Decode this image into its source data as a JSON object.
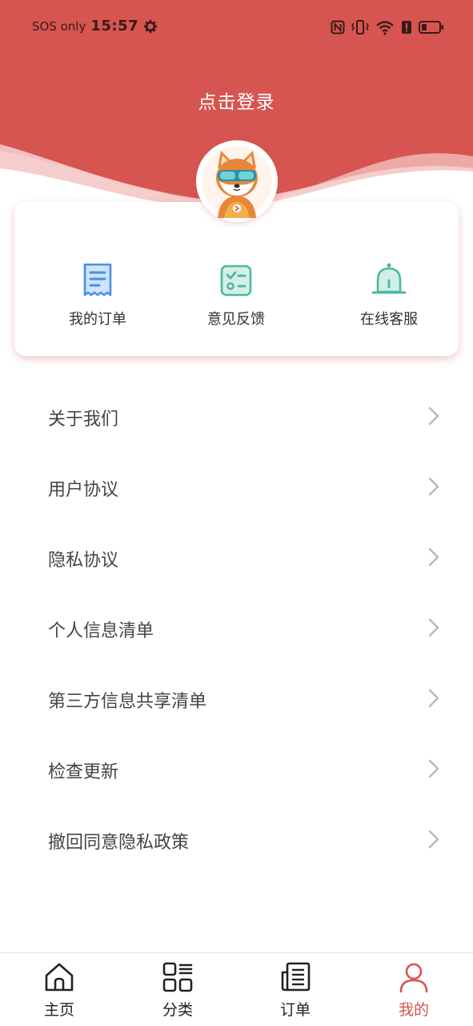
{
  "status_bar": {
    "carrier": "SOS only",
    "time": "15:57"
  },
  "header": {
    "login_text": "点击登录",
    "brand_color": "#d65550"
  },
  "quick_actions": [
    {
      "label": "我的订单",
      "icon": "order-doc-icon",
      "color": "#4a90e2"
    },
    {
      "label": "意见反馈",
      "icon": "feedback-checklist-icon",
      "color": "#4fb8a0"
    },
    {
      "label": "在线客服",
      "icon": "bell-icon",
      "color": "#4fb8a0"
    }
  ],
  "menu": [
    {
      "label": "关于我们"
    },
    {
      "label": "用户协议"
    },
    {
      "label": "隐私协议"
    },
    {
      "label": "个人信息清单"
    },
    {
      "label": "第三方信息共享清单"
    },
    {
      "label": "检查更新"
    },
    {
      "label": "撤回同意隐私政策"
    }
  ],
  "tabs": [
    {
      "label": "主页",
      "icon": "home-icon",
      "active": false
    },
    {
      "label": "分类",
      "icon": "category-grid-icon",
      "active": false
    },
    {
      "label": "订单",
      "icon": "newspaper-icon",
      "active": false
    },
    {
      "label": "我的",
      "icon": "user-icon",
      "active": true
    }
  ]
}
